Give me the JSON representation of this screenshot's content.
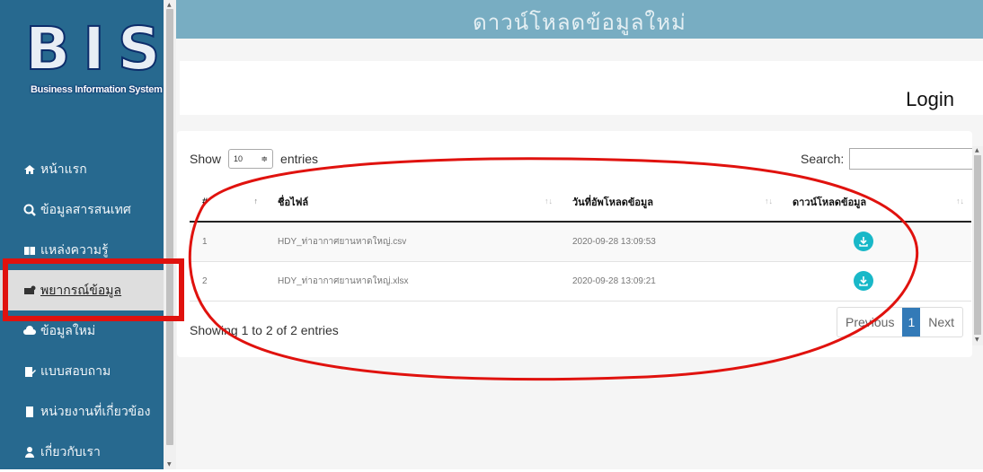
{
  "colors": {
    "sidebar": "#27698f",
    "topbar": "#78adc2",
    "accent": "#337ab7",
    "download": "#19b8c8",
    "annotation": "#e0120e"
  },
  "logo": {
    "letters": "BIS",
    "subtitle": "Business Information System"
  },
  "sidebar": {
    "items": [
      {
        "label": "หน้าแรก",
        "icon": "home-icon"
      },
      {
        "label": "ข้อมูลสารสนเทศ",
        "icon": "search-data-icon"
      },
      {
        "label": "แหล่งความรู้",
        "icon": "book-icon"
      },
      {
        "label": "พยากรณ์ข้อมูล",
        "icon": "forecast-icon"
      },
      {
        "label": "ข้อมูลใหม่",
        "icon": "cloud-icon"
      },
      {
        "label": "แบบสอบถาม",
        "icon": "edit-icon"
      },
      {
        "label": "หน่วยงานที่เกี่ยวข้อง",
        "icon": "building-icon"
      },
      {
        "label": "เกี่ยวกับเรา",
        "icon": "user-icon"
      }
    ],
    "active_index": 3
  },
  "header": {
    "title": "ดาวน์โหลดข้อมูลใหม่",
    "login": "Login"
  },
  "table": {
    "show_label": "Show",
    "entries_value": "10",
    "entries_label": "entries",
    "search_label": "Search:",
    "search_value": "",
    "columns": [
      "#",
      "ชื่อไฟล์",
      "วันที่อัพโหลดข้อมูล",
      "ดาวน์โหลดข้อมูล"
    ],
    "rows": [
      {
        "num": "1",
        "file": "HDY_ท่าอากาศยานหาดใหญ่.csv",
        "date": "2020-09-28 13:09:53",
        "download": "download-icon"
      },
      {
        "num": "2",
        "file": "HDY_ท่าอากาศยานหาดใหญ่.xlsx",
        "date": "2020-09-28 13:09:21",
        "download": "download-icon"
      }
    ],
    "info": "Showing 1 to 2 of 2 entries",
    "pagination": {
      "prev": "Previous",
      "current": "1",
      "next": "Next"
    }
  }
}
